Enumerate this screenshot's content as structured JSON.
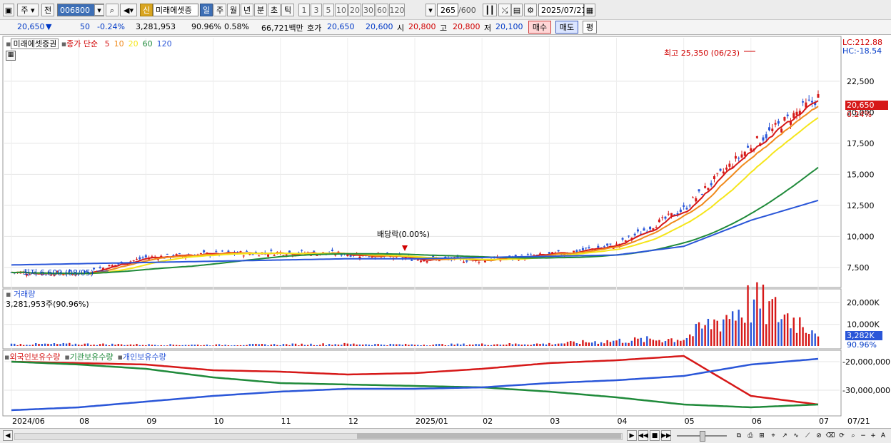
{
  "toolbar": {
    "market_label": "주",
    "prev_label": "전",
    "code_value": "006800",
    "sin_label": "신",
    "stock_name": "미래에셋증",
    "periods": [
      "일",
      "주",
      "월",
      "년",
      "분",
      "초",
      "틱"
    ],
    "active_period": "일",
    "intervals": [
      "1",
      "3",
      "5",
      "10",
      "20",
      "30",
      "60",
      "120"
    ],
    "count_value": "265",
    "count_total": "/600",
    "date_value": "2025/07/21"
  },
  "infobar": {
    "price": "20,650",
    "change": "50",
    "change_pct": "-0.24%",
    "volume": "3,281,953",
    "volume_ratio": "90.96%",
    "turnover_ratio": "0.58%",
    "amount": "66,721백만",
    "ask_label": "호가",
    "ask": "20,650",
    "bid": "20,600",
    "open_label": "시",
    "open": "20,800",
    "high_label": "고",
    "high": "20,800",
    "low_label": "저",
    "low": "20,100",
    "buy_label": "매수",
    "sell_label": "매도",
    "avg_label": "평"
  },
  "price_pane": {
    "name": "미래에셋증권",
    "legend_prefix": "종가 단순",
    "ma_periods": [
      "5",
      "10",
      "20",
      "60",
      "120"
    ],
    "ma_colors": [
      "#d61818",
      "#f08a1c",
      "#f5e51a",
      "#1f8a3a",
      "#2a56d8"
    ],
    "lc": "LC:212.88",
    "hc": "HC:-18.54",
    "high_annot": "최고 25,350 (06/23)",
    "low_annot": "최저 6,600 (08/05)",
    "dividend_annot": "배당락(0.00%)",
    "current_price": "20,650",
    "current_pct": "0.24%",
    "y_ticks": [
      "22,500",
      "20,000",
      "17,500",
      "15,000",
      "12,500",
      "10,000",
      "7,500"
    ]
  },
  "volume_pane": {
    "title": "거래량",
    "value": "3,281,953주(90.96%)",
    "y_ticks": [
      "20,000K",
      "10,000K"
    ],
    "current": "3,282K",
    "current_pct": "90.96%"
  },
  "holdings_pane": {
    "legends": [
      "외국인보유수량",
      "기관보유수량",
      "개인보유수량"
    ],
    "colors": [
      "#d61818",
      "#1f8a3a",
      "#2a56d8"
    ],
    "y_ticks": [
      "-20,000,000",
      "-30,000,000"
    ]
  },
  "x_axis": [
    "2024/06",
    "08",
    "09",
    "10",
    "11",
    "12",
    "2025/01",
    "02",
    "03",
    "04",
    "05",
    "06",
    "07",
    "07/21"
  ],
  "chart_data": {
    "type": "line",
    "title": "미래에셋증권",
    "x": [
      "2024/06",
      "08",
      "09",
      "10",
      "11",
      "12",
      "2025/01",
      "02",
      "03",
      "04",
      "05",
      "06",
      "07"
    ],
    "series": [
      {
        "name": "종가",
        "values": [
          7100,
          7000,
          8300,
          8600,
          8700,
          8600,
          8200,
          8100,
          8500,
          9300,
          12200,
          17300,
          21200
        ]
      },
      {
        "name": "120",
        "values": [
          7700,
          7800,
          7900,
          8000,
          8100,
          8200,
          8200,
          8300,
          8400,
          8500,
          9200,
          11300,
          12900
        ]
      }
    ],
    "ylim": [
      6000,
      26000
    ],
    "annotations": [
      "최고 25,350 (06/23)",
      "최저 6,600 (08/05)",
      "배당락(0.00%)"
    ],
    "volume_series": [
      {
        "name": "거래량",
        "values": [
          800,
          900,
          600,
          500,
          700,
          900,
          600,
          800,
          1000,
          2400,
          3400,
          20000,
          8000
        ]
      }
    ],
    "holdings_series": [
      {
        "name": "외국인보유수량",
        "values": [
          -20000000,
          -20500000,
          -21000000,
          -23000000,
          -23500000,
          -24500000,
          -24000000,
          -22500000,
          -20500000,
          -19500000,
          -18000000,
          -32000000,
          -35000000
        ]
      },
      {
        "name": "기관보유수량",
        "values": [
          -20000000,
          -21000000,
          -22500000,
          -25500000,
          -27500000,
          -28000000,
          -28500000,
          -29000000,
          -30500000,
          -32500000,
          -35000000,
          -36000000,
          -35000000
        ]
      },
      {
        "name": "개인보유수량",
        "values": [
          -37000000,
          -36000000,
          -34000000,
          -32000000,
          -30500000,
          -29500000,
          -29500000,
          -29000000,
          -27500000,
          -26500000,
          -25000000,
          -21000000,
          -19000000
        ]
      }
    ]
  }
}
